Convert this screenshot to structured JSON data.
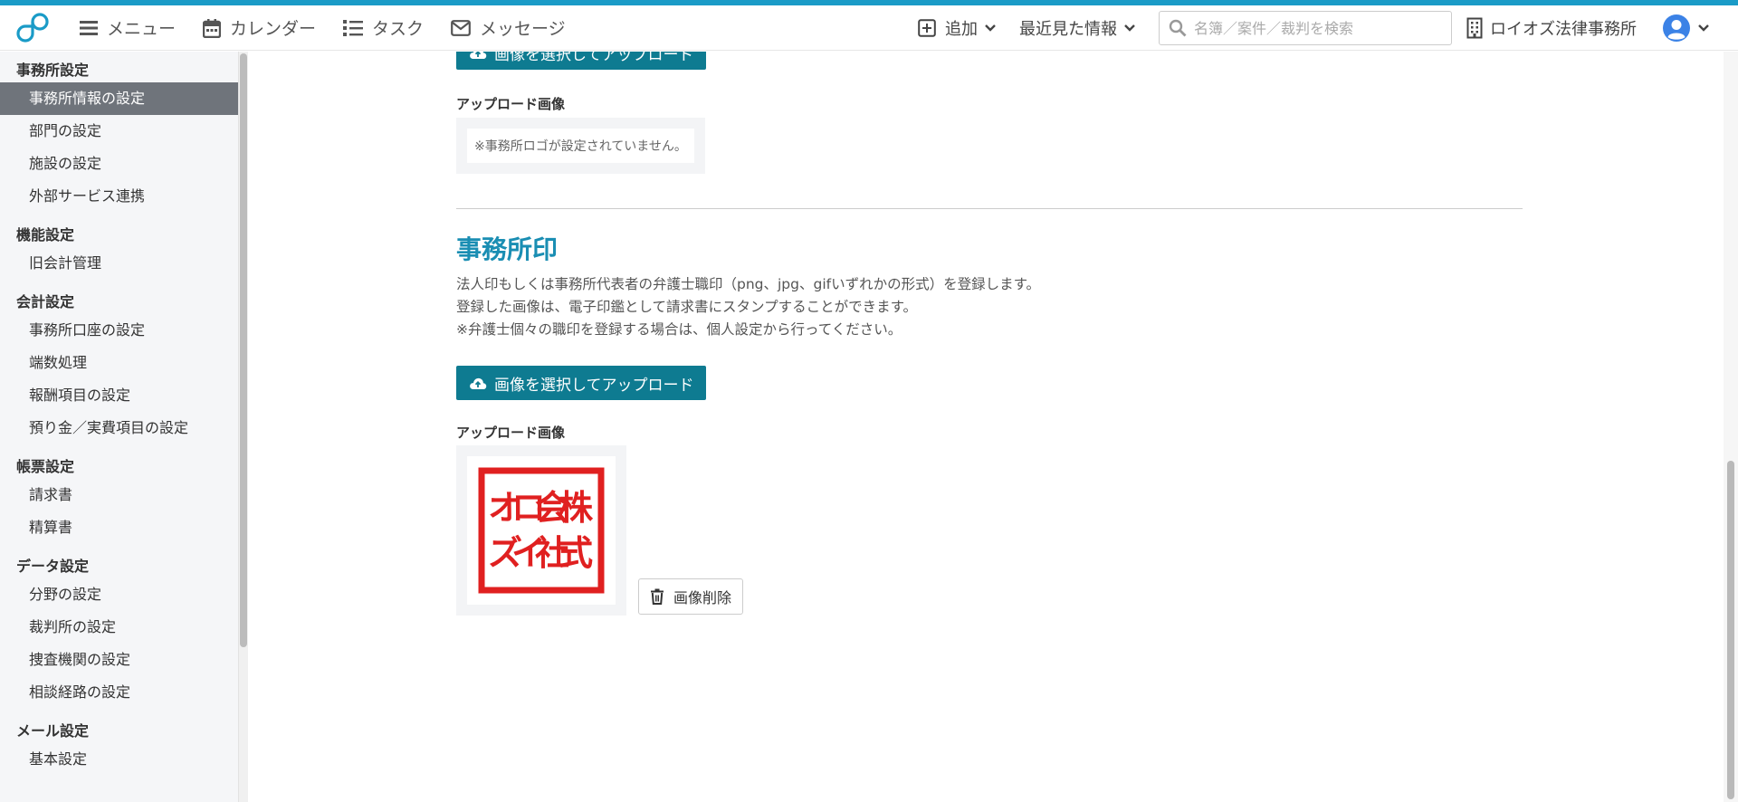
{
  "colors": {
    "accent": "#1a9bc7",
    "primary_button": "#0e7b91",
    "heading": "#1a8eb3",
    "sidebar_active": "#6f747b"
  },
  "header": {
    "nav": [
      {
        "icon": "menu-icon",
        "label": "メニュー"
      },
      {
        "icon": "calendar-icon",
        "label": "カレンダー"
      },
      {
        "icon": "task-list-icon",
        "label": "タスク"
      },
      {
        "icon": "mail-icon",
        "label": "メッセージ"
      }
    ],
    "add_label": "追加",
    "recent_label": "最近見た情報",
    "search_placeholder": "名簿／案件／裁判を検索",
    "office_name": "ロイオズ法律事務所"
  },
  "sidebar": {
    "groups": [
      {
        "title": "事務所設定",
        "items": [
          "事務所情報の設定",
          "部門の設定",
          "施設の設定",
          "外部サービス連携"
        ]
      },
      {
        "title": "機能設定",
        "items": [
          "旧会計管理"
        ]
      },
      {
        "title": "会計設定",
        "items": [
          "事務所口座の設定",
          "端数処理",
          "報酬項目の設定",
          "預り金／実費項目の設定"
        ]
      },
      {
        "title": "帳票設定",
        "items": [
          "請求書",
          "精算書"
        ]
      },
      {
        "title": "データ設定",
        "items": [
          "分野の設定",
          "裁判所の設定",
          "捜査機関の設定",
          "相談経路の設定"
        ]
      },
      {
        "title": "メール設定",
        "items": [
          "基本設定"
        ]
      }
    ],
    "active_item": "事務所情報の設定"
  },
  "main": {
    "logo_section": {
      "upload_button": "画像を選択してアップロード",
      "uploaded_label": "アップロード画像",
      "empty_message": "※事務所ロゴが設定されていません。"
    },
    "seal_section": {
      "title": "事務所印",
      "description": [
        "法人印もしくは事務所代表者の弁護士職印（png、jpg、gifいずれかの形式）を登録します。",
        "登録した画像は、電子印鑑として請求書にスタンプすることができます。",
        "※弁護士個々の職印を登録する場合は、個人設定から行ってください。"
      ],
      "upload_button": "画像を選択してアップロード",
      "uploaded_label": "アップロード画像",
      "seal_text": [
        "株式",
        "会社",
        "ロイ",
        "オズ"
      ],
      "delete_button": "画像削除"
    }
  }
}
